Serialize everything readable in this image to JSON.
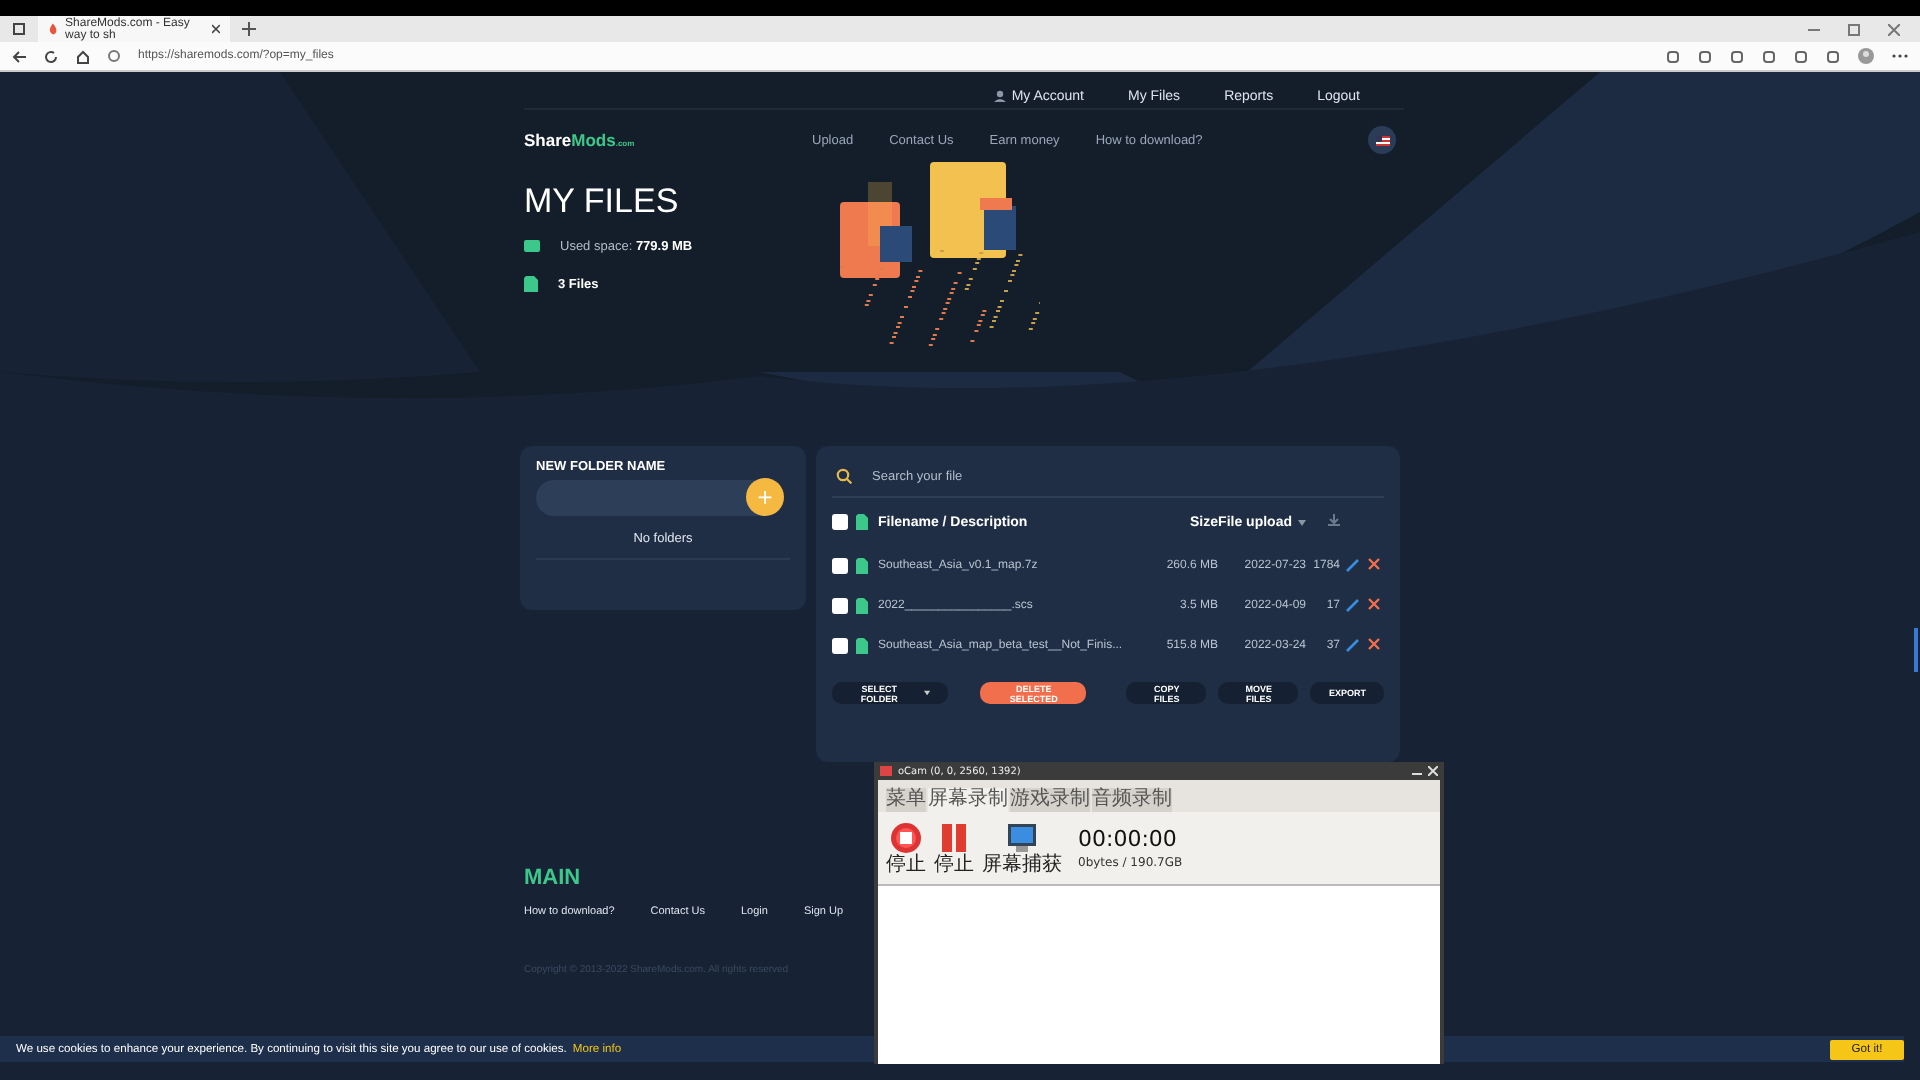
{
  "browser": {
    "tab_title": "ShareMods.com - Easy way to sh",
    "url": "https://sharemods.com/?op=my_files"
  },
  "top_nav": [
    "My Account",
    "My Files",
    "Reports",
    "Logout"
  ],
  "logo": {
    "main": "Share",
    "accent": "Mods",
    "suffix": ".com"
  },
  "main_nav": [
    "Upload",
    "Contact Us",
    "Earn money",
    "How to download?"
  ],
  "hero": {
    "title": "MY FILES",
    "used_space_label": "Used space:",
    "used_space_value": "779.9 MB",
    "files_count": "3 Files"
  },
  "folder_panel": {
    "title": "NEW FOLDER NAME",
    "add_label": "+",
    "empty_text": "No folders"
  },
  "files_panel": {
    "search_placeholder": "Search your file",
    "header_checked": false,
    "columns": [
      "Filename / Description",
      "Size",
      "File upload"
    ],
    "rows": [
      {
        "name": "Southeast_Asia_v0.1_map.7z",
        "size": "260.6 MB",
        "date": "2022-07-23",
        "downloads": "1784",
        "checked": false
      },
      {
        "name": "2022________________.scs",
        "size": "3.5 MB",
        "date": "2022-04-09",
        "downloads": "17",
        "checked": false
      },
      {
        "name": "Southeast_Asia_map_beta_test__Not_Finis...",
        "size": "515.8 MB",
        "date": "2022-03-24",
        "downloads": "37",
        "checked": false
      }
    ],
    "buttons": [
      {
        "label": "SELECT FOLDER",
        "kind": "dropdown"
      },
      {
        "label": "DELETE SELECTED",
        "kind": "danger"
      },
      {
        "label": "COPY FILES",
        "kind": "plain"
      },
      {
        "label": "MOVE FILES",
        "kind": "plain"
      },
      {
        "label": "EXPORT",
        "kind": "plain"
      }
    ]
  },
  "footer": {
    "title": "MAIN",
    "links": [
      "How to download?",
      "Contact Us",
      "Login",
      "Sign Up"
    ],
    "copyright": "Copyright © 2013-2022 ShareMods.com. All rights reserved"
  },
  "cookie_bar": {
    "text": "We use cookies to enhance your experience. By continuing to visit this site you agree to our use of cookies.",
    "link": "More info",
    "button": "Got it!"
  },
  "ocam": {
    "title": "oCam (0, 0, 2560, 1392)",
    "tabs": [
      {
        "label": "菜单",
        "selected": false
      },
      {
        "label": "屏幕录制",
        "selected": true
      },
      {
        "label": "游戏录制",
        "selected": false
      },
      {
        "label": "音频录制",
        "selected": false
      }
    ],
    "tools": [
      {
        "label": "停止",
        "kind": "stop"
      },
      {
        "label": "停止",
        "kind": "pause"
      },
      {
        "label": "屏幕捕获",
        "kind": "capture"
      }
    ],
    "timer": "00:00:00",
    "storage": "0bytes / 190.7GB"
  }
}
